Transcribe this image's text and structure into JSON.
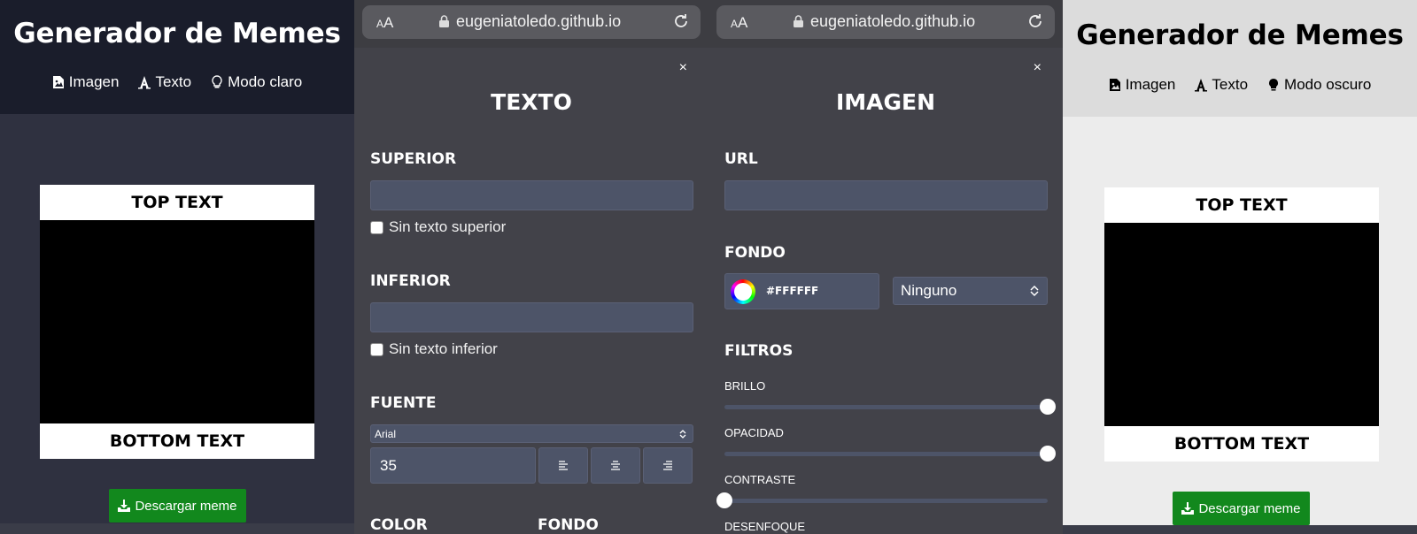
{
  "dark_main": {
    "title": "Generador de Memes",
    "nav": [
      "Imagen",
      "Texto",
      "Modo claro"
    ],
    "meme": {
      "top_text": "TOP TEXT",
      "bottom_text": "BOTTOM TEXT"
    },
    "download_label": "Descargar meme"
  },
  "text_panel": {
    "browser": {
      "aa_small": "A",
      "aa_big": "A",
      "url": "eugeniatoledo.github.io"
    },
    "close": "×",
    "title": "TEXTO",
    "superior": {
      "label": "SUPERIOR",
      "value": "",
      "checkbox_label": "Sin texto superior"
    },
    "inferior": {
      "label": "INFERIOR",
      "value": "",
      "checkbox_label": "Sin texto inferior"
    },
    "fuente": {
      "label": "FUENTE",
      "font": "Arial",
      "size": "35"
    },
    "color_label": "COLOR",
    "fondo_label": "FONDO"
  },
  "image_panel": {
    "browser": {
      "aa_small": "A",
      "aa_big": "A",
      "url": "eugeniatoledo.github.io"
    },
    "close": "×",
    "title": "IMAGEN",
    "url": {
      "label": "URL",
      "value": ""
    },
    "fondo": {
      "label": "FONDO",
      "color": "#FFFFFF",
      "blend": "Ninguno"
    },
    "filtros": {
      "label": "FILTROS",
      "sliders": [
        {
          "label": "BRILLO",
          "value": 1.0
        },
        {
          "label": "OPACIDAD",
          "value": 1.0
        },
        {
          "label": "CONTRASTE",
          "value": 0.0
        },
        {
          "label": "DESENFOQUE",
          "value": null
        }
      ]
    }
  },
  "light_main": {
    "title": "Generador de Memes",
    "nav": [
      "Imagen",
      "Texto",
      "Modo oscuro"
    ],
    "meme": {
      "top_text": "TOP TEXT",
      "bottom_text": "BOTTOM TEXT"
    },
    "download_label": "Descargar meme"
  },
  "colors": {
    "dark_header": "#1a1d2b",
    "dark_body": "#2f3140",
    "panel_bg": "#424249",
    "field_bg": "#4d5468",
    "download_green": "#12881d",
    "light_header": "#dcdcdc",
    "light_body": "#ececec"
  }
}
